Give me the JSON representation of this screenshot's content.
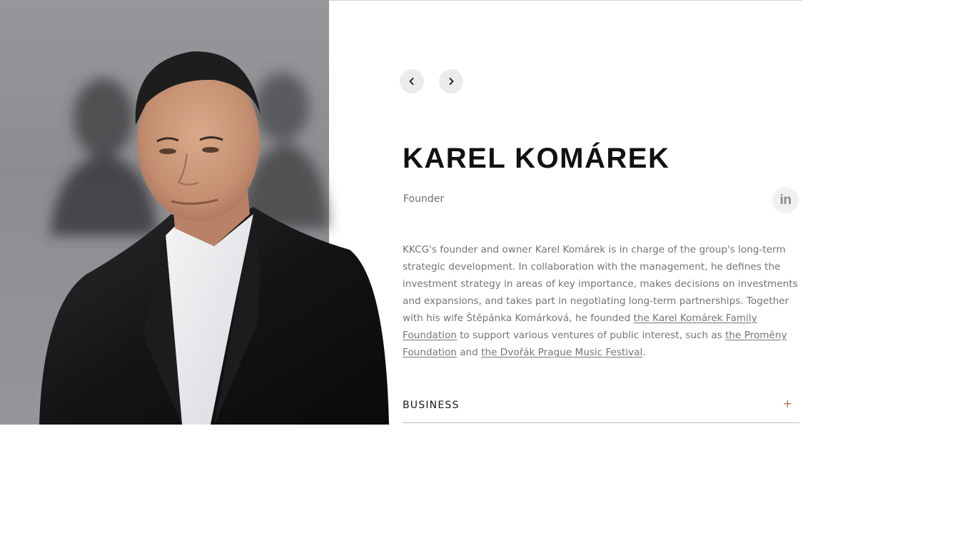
{
  "profile": {
    "name": "KAREL KOMÁREK",
    "role": "Founder",
    "linkedin_label": "in",
    "photo_alt": "Karel Komárek"
  },
  "nav": {
    "prev_icon": "chevron-left-icon",
    "next_icon": "chevron-right-icon"
  },
  "bio": {
    "text_1": "KKCG's founder and owner Karel Komárek is in charge of the group's long-term strategic development. In collaboration with the management, he defines the investment strategy in areas of key importance, makes decisions on investments and expansions, and takes part in negotiating long-term partnerships. Together with his wife Štěpánka Komárková, he founded ",
    "link_1": "the Karel Komárek Family Foundation",
    "text_2": " to support various ventures of public interest, such as ",
    "link_2": "the Proměny Foundation",
    "text_3": " and ",
    "link_3": "the Dvořák Prague Music Festival",
    "text_4": "."
  },
  "accordion": {
    "title": "BUSINESS",
    "toggle": "+"
  },
  "colors": {
    "accent": "#b07a4a",
    "text": "#747474",
    "heading": "#111111"
  }
}
